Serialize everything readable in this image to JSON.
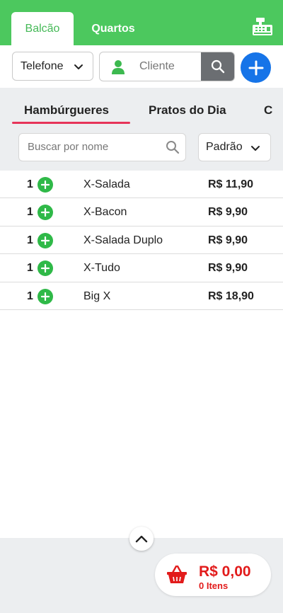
{
  "header": {
    "tabs": [
      {
        "label": "Balcão",
        "active": true
      },
      {
        "label": "Quartos",
        "active": false
      }
    ],
    "register_icon": "cash-register-icon"
  },
  "selectors": {
    "channel": "Telefone",
    "client_placeholder": "Cliente"
  },
  "categories": {
    "tabs": [
      "Hambúrgueres",
      "Pratos do Dia",
      "C"
    ],
    "active_index": 0
  },
  "search": {
    "placeholder": "Buscar por nome",
    "sort": "Padrão"
  },
  "products": [
    {
      "qty": "1",
      "name": "X-Salada",
      "price": "R$ 11,90"
    },
    {
      "qty": "1",
      "name": "X-Bacon",
      "price": "R$ 9,90"
    },
    {
      "qty": "1",
      "name": "X-Salada Duplo",
      "price": "R$ 9,90"
    },
    {
      "qty": "1",
      "name": "X-Tudo",
      "price": "R$ 9,90"
    },
    {
      "qty": "1",
      "name": "Big X",
      "price": "R$ 18,90"
    }
  ],
  "cart": {
    "total": "R$ 0,00",
    "items": "0 Itens"
  },
  "colors": {
    "header_green": "#4cc85e",
    "add_blue": "#1674e8",
    "plus_green": "#2fb948",
    "accent_red": "#e21b1b",
    "underline_pink": "#e63459"
  }
}
